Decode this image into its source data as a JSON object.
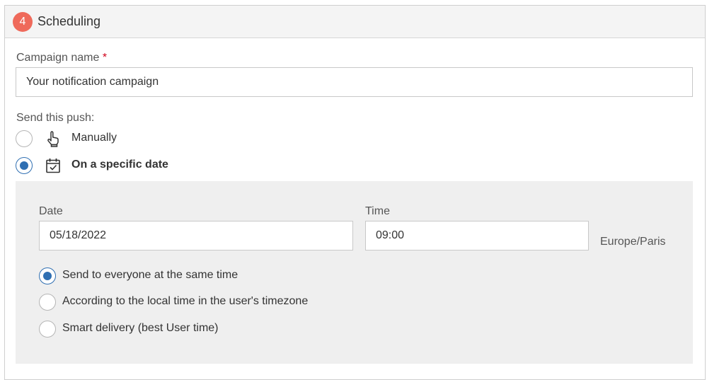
{
  "section": {
    "step_number": "4",
    "title": "Scheduling"
  },
  "campaign": {
    "label": "Campaign name",
    "required_mark": "*",
    "value": "Your notification campaign"
  },
  "send": {
    "label": "Send this push:",
    "options": [
      {
        "label": "Manually",
        "icon": "hand-pointer-icon",
        "selected": false
      },
      {
        "label": "On a specific date",
        "icon": "calendar-check-icon",
        "selected": true
      }
    ]
  },
  "schedule": {
    "date_label": "Date",
    "date_value": "05/18/2022",
    "time_label": "Time",
    "time_value": "09:00",
    "timezone": "Europe/Paris",
    "delivery_options": [
      {
        "label": "Send to everyone at the same time",
        "selected": true
      },
      {
        "label": "According to the local time in the user's timezone",
        "selected": false
      },
      {
        "label": "Smart delivery (best User time)",
        "selected": false
      }
    ]
  },
  "colors": {
    "badge": "#ef6a5b",
    "radio_selected": "#2f6fb2",
    "required": "#d0021b",
    "sub_panel_bg": "#efefef"
  }
}
